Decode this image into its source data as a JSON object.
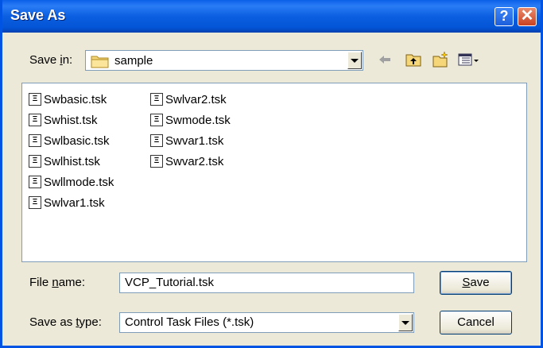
{
  "window": {
    "title": "Save As"
  },
  "titlebar_buttons": {
    "help": "?",
    "close": "✕"
  },
  "save_in": {
    "label_pre": "Save ",
    "label_u": "i",
    "label_post": "n:",
    "folder": "sample"
  },
  "files_col1": [
    "Swbasic.tsk",
    "Swhist.tsk",
    "Swlbasic.tsk",
    "Swlhist.tsk",
    "Swllmode.tsk",
    "Swlvar1.tsk"
  ],
  "files_col2": [
    "Swlvar2.tsk",
    "Swmode.tsk",
    "Swvar1.tsk",
    "Swvar2.tsk"
  ],
  "file_name": {
    "label_pre": "File ",
    "label_u": "n",
    "label_post": "ame:",
    "value": "VCP_Tutorial.tsk"
  },
  "save_as_type": {
    "label_pre": "Save as ",
    "label_u": "t",
    "label_post": "ype:",
    "value": "Control Task Files (*.tsk)"
  },
  "buttons": {
    "save_u": "S",
    "save_rest": "ave",
    "cancel": "Cancel"
  }
}
